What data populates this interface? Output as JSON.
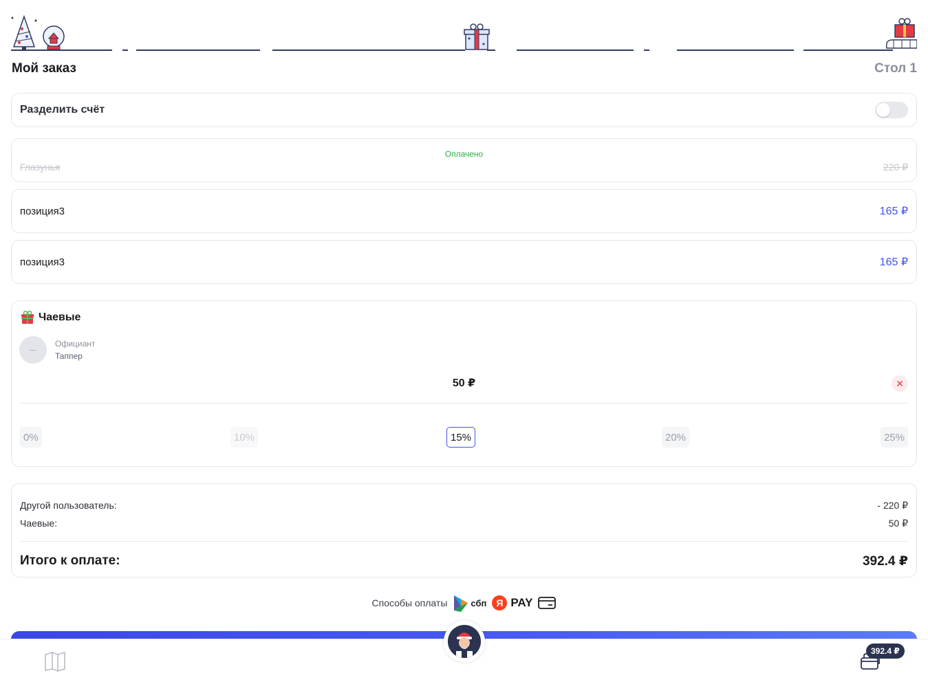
{
  "header": {
    "title": "Мой заказ",
    "table": "Стол 1"
  },
  "split_bill": {
    "label": "Разделить счёт",
    "enabled": false
  },
  "order_items": [
    {
      "name": "Глазунья",
      "price": "220 ₽",
      "status": "Оплачено"
    },
    {
      "name": "позиция3",
      "price": "165 ₽"
    },
    {
      "name": "позиция3",
      "price": "165 ₽"
    }
  ],
  "tips": {
    "title": "Чаевые",
    "waiter_role": "Официант",
    "waiter_name": "Таппер",
    "amount": "50 ₽",
    "percents": [
      "0%",
      "10%",
      "15%",
      "20%",
      "25%"
    ],
    "selected": "15%"
  },
  "summary": {
    "other_user_label": "Другой пользователь:",
    "other_user_value": "- 220 ₽",
    "tips_label": "Чаевые:",
    "tips_value": "50 ₽",
    "total_label": "Итого к оплате:",
    "total_value": "392.4 ₽"
  },
  "payment": {
    "label": "Способы оплаты",
    "sbp": "сбп",
    "yandex_pay_letter": "Я",
    "yandex_pay": "PAY"
  },
  "bottom_nav": {
    "cart_total": "392.4 ₽"
  },
  "colors": {
    "accent": "#4152f0",
    "paid": "#2fab4b",
    "danger": "#e53945"
  }
}
